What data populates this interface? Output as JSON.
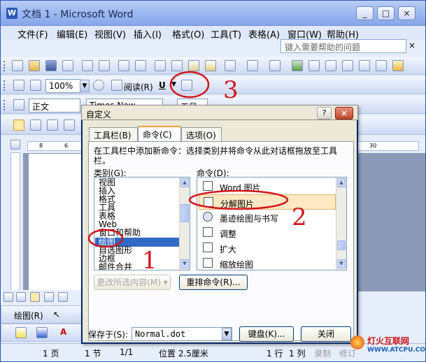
{
  "window": {
    "app_icon": "W",
    "title": "文档 1 - Microsoft Word",
    "buttons": [
      "_",
      "□",
      "×"
    ]
  },
  "menu": [
    "文件(F)",
    "编辑(E)",
    "视图(V)",
    "插入(I)",
    "格式(O)",
    "工具(T)",
    "表格(A)",
    "窗口(W)",
    "帮助(H)"
  ],
  "help_search": {
    "placeholder": "键入需要帮助的问题",
    "arrow": "×"
  },
  "toolbar2": {
    "zoom": "100%",
    "read_label": "阅读(R)",
    "underline": "U"
  },
  "toolbar3": {
    "style": "正文",
    "font": "Times New Roma",
    "size": "五号"
  },
  "ruler_ticks": [
    "8",
    "6",
    "4",
    "2",
    "2",
    "4",
    "6",
    "8",
    "10",
    "12",
    "14",
    "16",
    "18",
    "20",
    "22",
    "24",
    "26",
    "28",
    "30"
  ],
  "draw_toolbar": {
    "label": "绘图(R)"
  },
  "status": [
    "1 页",
    "1 节",
    "1/1",
    "位置 2.5厘米",
    "1 行",
    "1 列",
    "录制",
    "修订"
  ],
  "dialog": {
    "title": "自定义",
    "help_btn": "?",
    "close_btn": "×",
    "tabs": [
      "工具栏(B)",
      "命令(C)",
      "选项(O)"
    ],
    "active_tab": 1,
    "instruction": "在工具栏中添加新命令：选择类别并将命令从此对话框拖放至工具栏。",
    "categories_label": "类别(G):",
    "commands_label": "命令(D):",
    "categories": [
      "视图",
      "插入",
      "格式",
      "工具",
      "表格",
      "Web",
      "窗口和帮助",
      "绘图",
      "自选图形",
      "边框",
      "邮件合并"
    ],
    "selected_category": 7,
    "commands": [
      {
        "label": "Word 图片",
        "icon": "picture-icon"
      },
      {
        "label": "分解图片",
        "icon": "ungroup-picture-icon",
        "highlight": true
      },
      {
        "label": "墨迹绘图与书写",
        "icon": "ink-pen-icon"
      },
      {
        "label": "调整",
        "icon": "adjust-icon"
      },
      {
        "label": "扩大",
        "icon": "expand-icon"
      },
      {
        "label": "缩放绘图",
        "icon": "scale-drawing-icon"
      }
    ],
    "modify_selection": "更改所选内容(M) ▾",
    "rearrange": "重排命令(R)...",
    "save_in_label": "保存于(S):",
    "save_in_value": "Normal.dot",
    "keyboard": "键盘(K)...",
    "close": "关闭"
  },
  "annotations": {
    "n1": "1",
    "n2": "2",
    "n3": "3",
    "red": "#d0161c"
  },
  "watermark": {
    "line1": "灯火互联网",
    "line2": "WWW.ATCPU.COM"
  }
}
